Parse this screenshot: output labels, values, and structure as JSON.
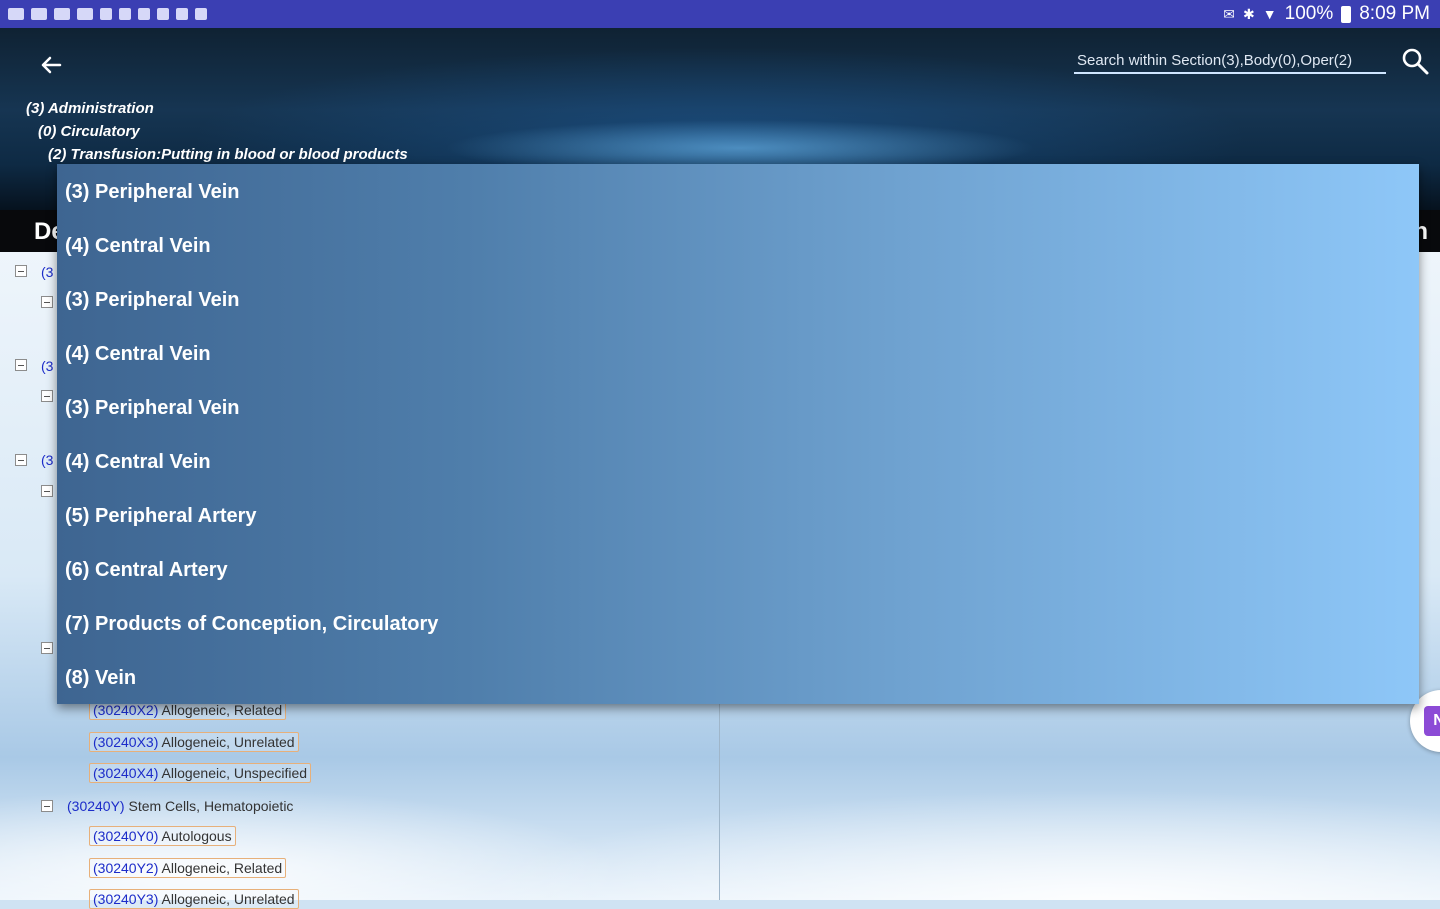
{
  "status_bar": {
    "battery": "100%",
    "time": "8:09 PM"
  },
  "header": {
    "back_icon": "back-arrow-icon",
    "search_placeholder": "Search within Section(3),Body(0),Oper(2)",
    "breadcrumbs": [
      "(3) Administration",
      "(0) Circulatory",
      "(2) Transfusion:Putting in blood or blood products"
    ]
  },
  "title_bar": {
    "title": "De",
    "right_fragment": "n"
  },
  "dropdown": {
    "items": [
      "(3) Peripheral Vein",
      "(4) Central Vein",
      "(3) Peripheral Vein",
      "(4) Central Vein",
      "(3) Peripheral Vein",
      "(4) Central Vein",
      "(5) Peripheral Artery",
      "(6) Central Artery",
      "(7) Products of Conception, Circulatory",
      "(8) Vein"
    ]
  },
  "tree": {
    "peek_prefixes": [
      "(3",
      "(3",
      "(3"
    ],
    "items_a": [
      {
        "code": "(30240X2)",
        "label": "Allogeneic, Related"
      },
      {
        "code": "(30240X3)",
        "label": "Allogeneic, Unrelated"
      },
      {
        "code": "(30240X4)",
        "label": "Allogeneic, Unspecified"
      }
    ],
    "parent": {
      "code": "(30240Y)",
      "label": "Stem Cells, Hematopoietic"
    },
    "items_b": [
      {
        "code": "(30240Y0)",
        "label": "Autologous"
      },
      {
        "code": "(30240Y2)",
        "label": "Allogeneic, Related"
      },
      {
        "code": "(30240Y3)",
        "label": "Allogeneic, Unrelated"
      }
    ]
  },
  "fab": {
    "label": "N"
  },
  "colors": {
    "status_bar": "#3b3fb3",
    "code_blue": "#1c2cc9",
    "item_border": "#e7b07a"
  }
}
